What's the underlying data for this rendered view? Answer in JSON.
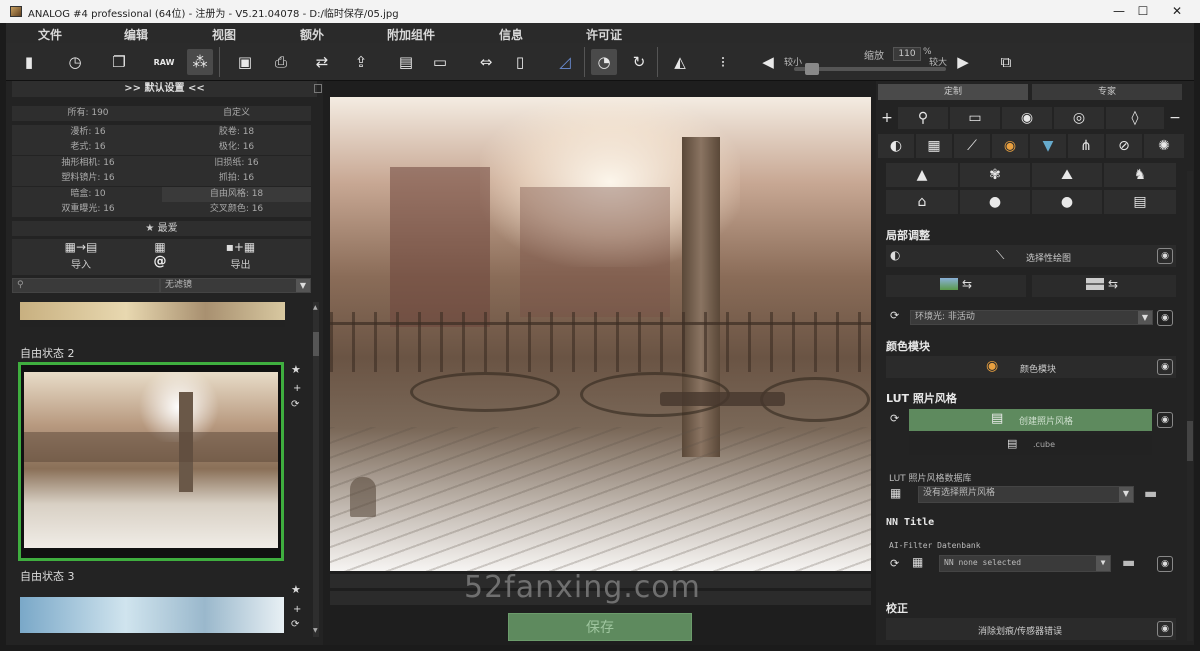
{
  "window": {
    "title": "ANALOG #4 professional (64位) - 注册为 - V5.21.04078 - D:/临时保存/05.jpg",
    "minimize": "—",
    "maximize": "☐",
    "close": "✕"
  },
  "menu": [
    "文件",
    "编辑",
    "视图",
    "额外",
    "附加组件",
    "信息",
    "许可证"
  ],
  "toolbar": {
    "zoom_label": "缩放",
    "zoom_value": "110",
    "zoom_unit": "%",
    "zoom_small": "较小",
    "zoom_large": "较大",
    "zoom_level": 0.08,
    "raw_label": "RAW"
  },
  "left": {
    "header": ">> 默认设置 <<",
    "presets": [
      [
        "所有: 190",
        "自定义"
      ],
      [
        "漫析: 16",
        "胶卷: 18"
      ],
      [
        "老式: 16",
        "极化: 16"
      ],
      [
        "抽形相机: 16",
        "旧损纸: 16"
      ],
      [
        "塑料镜片: 16",
        "抓拍: 16"
      ],
      [
        "暗盒: 10",
        "自由风格: 18"
      ],
      [
        "双重曝光: 16",
        "交叉颜色: 16"
      ]
    ],
    "favorites": "★ 最爱",
    "import_label": "导入",
    "export_label": "导出",
    "at_symbol": "@",
    "filter_value": "无滤镜",
    "thumbs": [
      {
        "label": "自由状态 2"
      },
      {
        "label": "自由状态 3"
      }
    ]
  },
  "main": {
    "save_label": "保存",
    "watermark": "52fanxing.com"
  },
  "right": {
    "tab_custom": "定制",
    "tab_expert": "专家",
    "local_adjust": "局部调整",
    "selective_brush": "选择性绘图",
    "ambient_light": "环境光: 非活动",
    "color_module_hdr": "颜色模块",
    "color_module": "颜色模块",
    "lut_hdr": "LUT 照片风格",
    "create_style": "创建照片风格",
    "cube_label": ".cube",
    "lut_db_label": "LUT 照片风格数据库",
    "lut_db_value": "没有选择照片风格",
    "nn_title": "NN Title",
    "ai_label": "AI-Filter Datenbank",
    "ai_value": "NN none selected",
    "correction_hdr": "校正",
    "correction_item": "消除划痕/传感器错误"
  },
  "colors": {
    "accent_green": "#5e8a5e",
    "selected_border": "#3fae3f",
    "panel_bg": "#232323",
    "titlebar_bg": "#f3f3f3"
  }
}
